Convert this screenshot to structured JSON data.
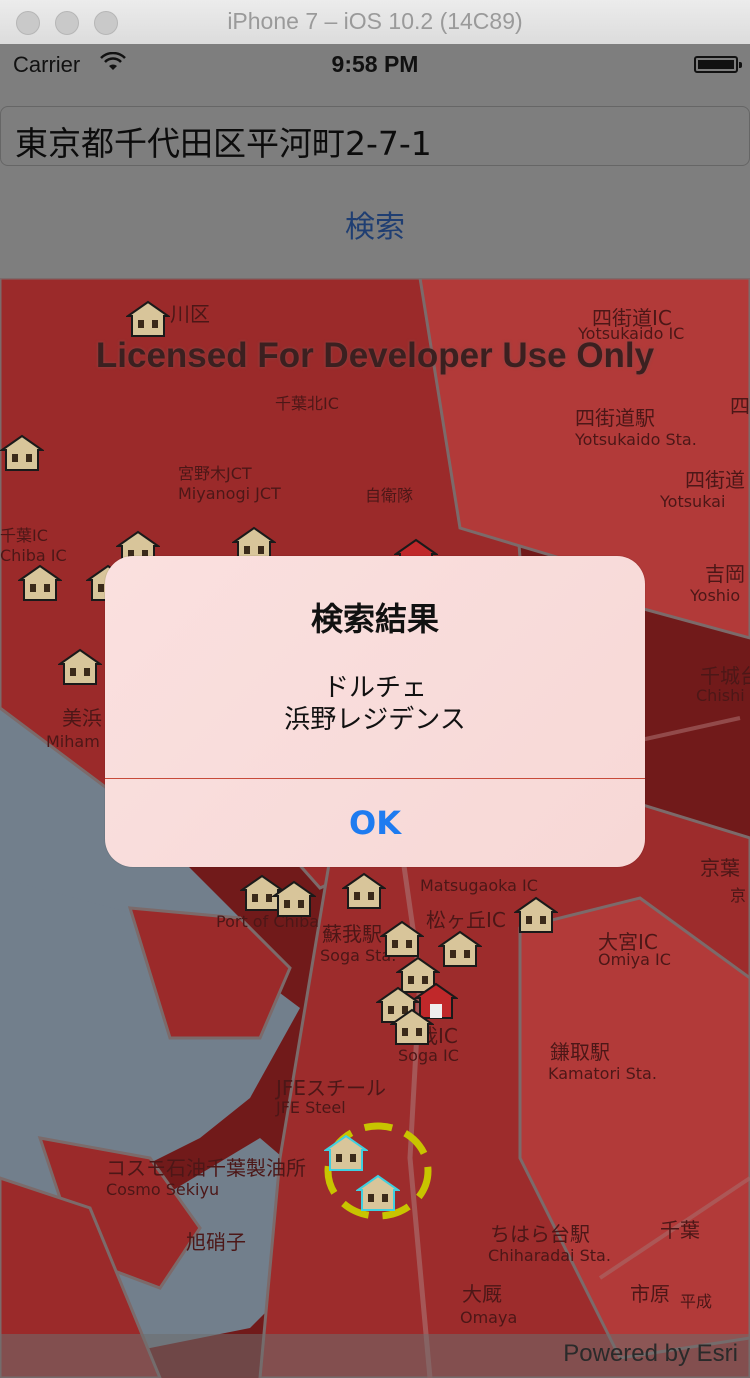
{
  "simulator": {
    "title": "iPhone 7 – iOS 10.2 (14C89)"
  },
  "status_bar": {
    "carrier": "Carrier",
    "time": "9:58 PM"
  },
  "search": {
    "address_value": "東京都千代田区平河町2-7-1",
    "button_label": "検索"
  },
  "map": {
    "watermark": "Licensed For Developer Use Only",
    "attribution": "Powered by Esri",
    "labels": {
      "l1": "川区",
      "l2": "Yotsukaido IC",
      "l3": "千葉北IC",
      "l4": "四街道駅",
      "l5": "Yotsukaido Sta.",
      "l6": "四街道",
      "l7": "Yotsukai",
      "l8": "宮野木JCT",
      "l9": "Miyanogi JCT",
      "l10": "自衛隊",
      "l11": "千葉IC",
      "l12": "Chiba IC",
      "l13": "吉岡",
      "l14": "Yoshio",
      "l15": "美浜",
      "l16": "Miham",
      "l17": "千城台",
      "l18": "Chishi",
      "l19": "Port of Chiba",
      "l20": "蘇我駅",
      "l21": "Soga Sta.",
      "l22": "松ヶ丘IC",
      "l23": "Matsugaoka IC",
      "l24": "大宮IC",
      "l25": "Omiya IC",
      "l26": "鎌取駅",
      "l27": "Kamatori Sta.",
      "l28": "JFEスチール",
      "l29": "JFE Steel",
      "l30": "コスモ石油千葉製油所",
      "l31": "Cosmo Sekiyu",
      "l32": "旭硝子",
      "l33": "ちはら台駅",
      "l34": "Chiharadai Sta.",
      "l35": "大厩",
      "l36": "Omaya",
      "l37": "市原",
      "l38": "蘇我IC",
      "l39": "Soga IC",
      "l40": "京葉",
      "l41": "四街道IC",
      "l42": "千葉",
      "l43": "平成",
      "l44": "四",
      "l45": "京"
    }
  },
  "alert": {
    "title": "検索結果",
    "message_line1": "ドルチェ",
    "message_line2": "浜野レジデンス",
    "ok_label": "OK"
  },
  "colors": {
    "map_region": "#9b2a2a",
    "map_region_light": "#b23a39",
    "water": "#727f8c",
    "alert_ok": "#1e7bf0",
    "selection_ring": "#c8c400"
  }
}
